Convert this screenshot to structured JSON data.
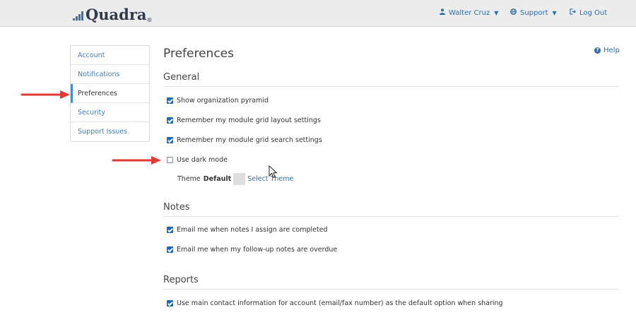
{
  "header": {
    "logo_text": "Quadra",
    "logo_mark": "®",
    "user_name": "Walter Cruz",
    "support_label": "Support",
    "logout_label": "Log Out"
  },
  "sidebar": {
    "items": [
      {
        "label": "Account"
      },
      {
        "label": "Notifications"
      },
      {
        "label": "Preferences",
        "active": true
      },
      {
        "label": "Security"
      },
      {
        "label": "Support Issues"
      }
    ]
  },
  "main": {
    "title": "Preferences",
    "help_label": "Help",
    "sections": [
      {
        "title": "General",
        "options": [
          {
            "label": "Show organization pyramid",
            "checked": true
          },
          {
            "label": "Remember my module grid layout settings",
            "checked": true
          },
          {
            "label": "Remember my module grid search settings",
            "checked": true
          },
          {
            "label": "Use dark mode",
            "checked": false
          }
        ],
        "theme": {
          "label": "Theme",
          "value": "Default",
          "select_label": "Select Theme"
        }
      },
      {
        "title": "Notes",
        "options": [
          {
            "label": "Email me when notes I assign are completed",
            "checked": true
          },
          {
            "label": "Email me when my follow-up notes are overdue",
            "checked": true
          }
        ]
      },
      {
        "title": "Reports",
        "options": [
          {
            "label": "Use main contact information for account (email/fax number) as the default option when sharing",
            "checked": true
          }
        ]
      }
    ]
  },
  "colors": {
    "link": "#2f6ea8",
    "checkbox": "#2468b4",
    "annotation_arrow": "#e53935"
  },
  "icons": [
    "user-icon",
    "globe-icon",
    "logout-icon",
    "help-icon",
    "checkbox-checked-icon",
    "checkbox-unchecked-icon",
    "red-arrow-annotation",
    "mouse-cursor-icon"
  ]
}
